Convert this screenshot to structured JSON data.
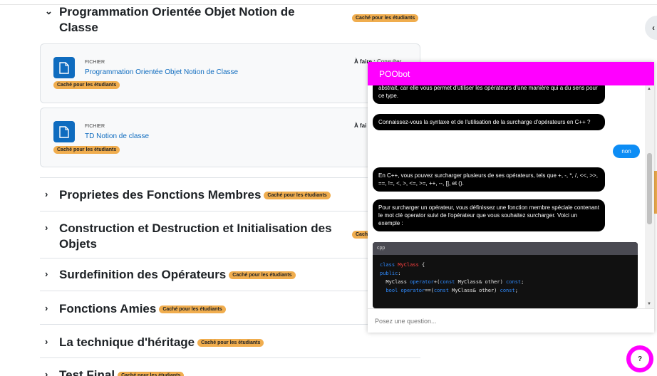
{
  "badge_text": "Caché pour les étudiants",
  "sections": [
    {
      "title": "Programmation Orientée Objet Notion de",
      "title_line2": "Classe",
      "expanded": true
    },
    {
      "title": "Proprietes des Fonctions Membres"
    },
    {
      "title": "Construction et Destruction et Initialisation des",
      "title_line2": "Objets"
    },
    {
      "title": "Surdefinition des Opérateurs"
    },
    {
      "title": "Fonctions Amies"
    },
    {
      "title": "La technique d'héritage"
    },
    {
      "title": "Test Final"
    }
  ],
  "activities": [
    {
      "kind": "FICHIER",
      "name": "Programmation Orientée Objet Notion de Classe",
      "todo": "À faire :",
      "todo_action": "Consulter"
    },
    {
      "kind": "FICHIER",
      "name": "TD Notion de classe",
      "todo": "À fai"
    }
  ],
  "chatbot": {
    "title": "POObot",
    "messages": [
      {
        "from": "bot",
        "text": "abstrait, car elle vous permet d'utiliser les opérateurs d'une manière qui a du sens pour ce type."
      },
      {
        "from": "bot",
        "text": "Connaissez-vous la syntaxe et de l'utilisation de la surcharge d'opérateurs en C++ ?"
      },
      {
        "from": "user",
        "text": "non"
      },
      {
        "from": "bot",
        "text": "En C++, vous pouvez surcharger plusieurs de ses opérateurs, tels que +, -, *, /, <<, >>, ==, !=, <, >, <=, >=, ++, --, [], et ()."
      },
      {
        "from": "bot",
        "text": "Pour surcharger un opérateur, vous définissez une fonction membre spéciale contenant le mot clé operator suivi de l'opérateur que vous souhaitez surcharger. Voici un exemple :"
      }
    ],
    "code_lang": "cpp",
    "code_lines": [
      "class MyClass {",
      "public:",
      "  MyClass operator+(const MyClass& other) const;",
      "  bool operator==(const MyClass& other) const;"
    ],
    "input_placeholder": "Posez une question..."
  },
  "help_label": "?",
  "drawer_icon": "chevron-left-icon",
  "colors": {
    "accent": "#ff00ff",
    "badge": "#f0ad4e",
    "link": "#0f6cbf",
    "user_bubble": "#0d8df5"
  }
}
